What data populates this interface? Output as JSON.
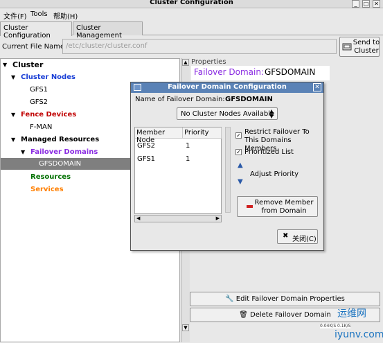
{
  "window": {
    "title": "Cluster Configuration"
  },
  "menu": [
    "文件(F)",
    "Tools",
    "帮助(H)"
  ],
  "tabs": [
    "Cluster Configuration",
    "Cluster Management"
  ],
  "file": {
    "label": "Current File Name:",
    "value": "/etc/cluster/cluster.conf"
  },
  "send_button": {
    "line1": "Send to",
    "line2": "Cluster"
  },
  "tree": {
    "cluster": "Cluster",
    "cluster_nodes": "Cluster Nodes",
    "nodes": [
      "GFS1",
      "GFS2"
    ],
    "fence_devices": "Fence Devices",
    "fence_items": [
      "F-MAN"
    ],
    "managed_resources": "Managed Resources",
    "failover_domains": "Failover Domains",
    "domains": [
      "GFSDOMAIN"
    ],
    "resources": "Resources",
    "services": "Services"
  },
  "colors": {
    "cluster_nodes": "#1a3fd6",
    "fence_devices": "#c00000",
    "failover_domains": "#8a2be2",
    "resources": "#007000",
    "services": "#ff7f00",
    "selected_row": "#7f7f7f"
  },
  "properties": {
    "label": "Properties",
    "domain_label": "Failover Domain:",
    "domain_value": "GFSDOMAIN"
  },
  "buttons": {
    "edit": "Edit Failover Domain Properties",
    "delete": "Delete Failover Domain"
  },
  "dialog": {
    "title": "Failover Domain Configuration",
    "name_label": "Name of Failover Domain:",
    "name_value": "GFSDOMAIN",
    "dropdown": "No Cluster Nodes Available",
    "columns": [
      "Member Node",
      "Priority"
    ],
    "rows": [
      {
        "node": "GFS2",
        "priority": "1"
      },
      {
        "node": "GFS1",
        "priority": "1"
      }
    ],
    "restrict_line1": "Restrict Failover To",
    "restrict_line2": "This Domains Members",
    "prioritized": "Prioritized List",
    "adjust": "Adjust Priority",
    "remove_line1": "Remove Member",
    "remove_line2": "from Domain",
    "close": "关闭(C)"
  },
  "watermark": {
    "site": "运维网",
    "domain": "iyunv.com",
    "net": "0.04K/S  0.1K/S"
  }
}
